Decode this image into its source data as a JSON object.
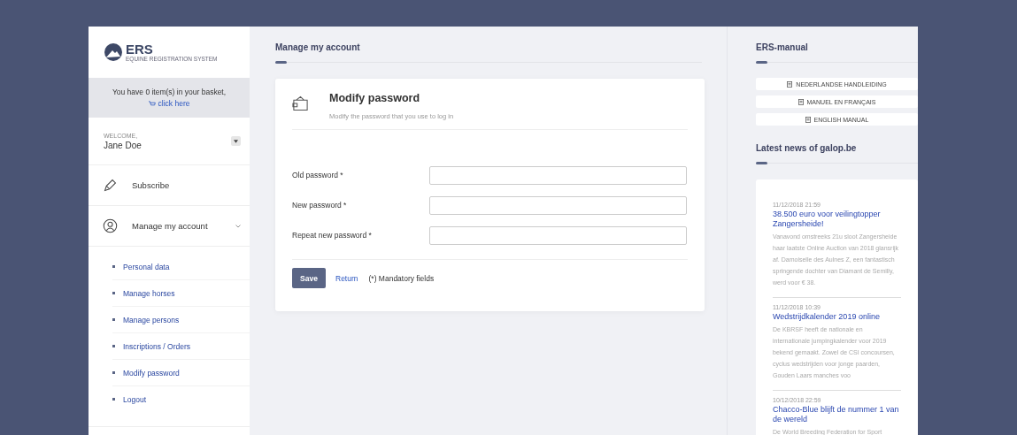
{
  "logo": {
    "title": "ERS",
    "subtitle": "EQUINE REGISTRATION SYSTEM"
  },
  "basket": {
    "text": "You have 0 item(s) in your basket,",
    "link": "click here"
  },
  "user": {
    "welcome": "WELCOME,",
    "name": "Jane Doe"
  },
  "menu": [
    {
      "label": "Subscribe",
      "kind": "pencil"
    },
    {
      "label": "Manage my account",
      "kind": "user",
      "expanded": true,
      "children": [
        "Personal data",
        "Manage horses",
        "Manage persons",
        "Inscriptions / Orders",
        "Modify password",
        "Logout"
      ]
    }
  ],
  "main": {
    "heading": "Manage my account",
    "card": {
      "title": "Modify password",
      "subtitle": "Modify the password that you use to log in",
      "fields": [
        {
          "label": "Old password *"
        },
        {
          "label": "New password *"
        },
        {
          "label": "Repeat new password *"
        }
      ],
      "save": "Save",
      "return": "Return",
      "note": "(*) Mandatory fields"
    }
  },
  "manual": {
    "heading": "ERS-manual",
    "buttons": [
      "NEDERLANDSE HANDLEIDING",
      "MANUEL EN FRANÇAIS",
      "ENGLISH MANUAL"
    ]
  },
  "news": {
    "heading": "Latest news of galop.be",
    "items": [
      {
        "date": "11/12/2018 21:59",
        "title": "38.500 euro voor veilingtopper Zangersheide!",
        "text": "Vanavond omstreeks 21u sloot Zangersheide haar laatste Online Auction van 2018 glansrijk af. Damoiselle des Aulnes Z, een fantastisch springende dochter van Diamant de Semilly, werd voor € 38."
      },
      {
        "date": "11/12/2018 10:39",
        "title": "Wedstrijdkalender 2019 online",
        "text": "De KBRSF heeft de nationale en internationale jumpingkalender voor 2019 bekend gemaakt.  Zowel de CSI concoursen, cyclus wedstrijden voor jonge paarden, Gouden Laars manches voo"
      },
      {
        "date": "10/12/2018 22:59",
        "title": "Chacco-Blue blijft de nummer 1 van de wereld",
        "text": "De World Breeding Federation for Sport"
      }
    ]
  }
}
